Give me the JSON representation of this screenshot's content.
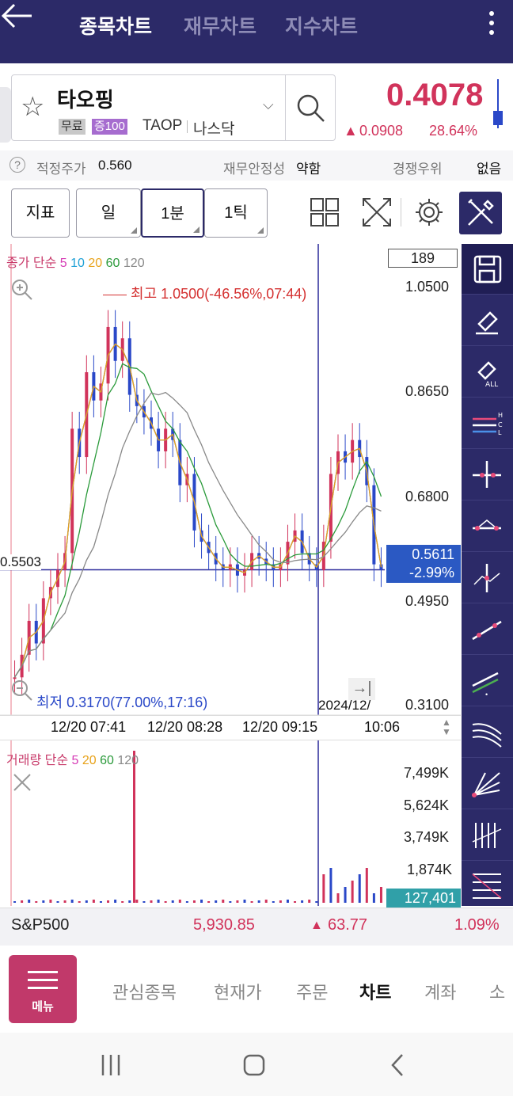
{
  "header": {
    "tabs": [
      {
        "label": "종목차트",
        "active": true
      },
      {
        "label": "재무차트",
        "active": false
      },
      {
        "label": "지수차트",
        "active": false
      }
    ]
  },
  "stock": {
    "name": "타오핑",
    "badges": [
      "무료",
      "증100"
    ],
    "ticker": "TAOP",
    "exchange": "나스닥",
    "price": "0.4078",
    "change": "0.0908",
    "change_pct": "28.64%"
  },
  "info": {
    "fair_price_label": "적정주가",
    "fair_price_value": "0.560",
    "fin_stability_label": "재무안정성",
    "fin_stability_value": "약함",
    "competition_label": "경쟁우위",
    "competition_value": "없음"
  },
  "toolbar": {
    "indicator": "지표",
    "day": "일",
    "minute": "1분",
    "tick": "1틱"
  },
  "chart_data": [
    {
      "type": "candlestick",
      "legend": {
        "prefix": "종가 단순",
        "periods": [
          "5",
          "10",
          "20",
          "60",
          "120"
        ]
      },
      "count_box": "189",
      "y_ticks": [
        "1.0500",
        "0.8650",
        "0.6800",
        "0.4950",
        "0.3100"
      ],
      "ylim": [
        0.31,
        1.05
      ],
      "high_annotation": "최고 1.0500(-46.56%,07:44)",
      "low_annotation": "최저 0.3170(77.00%,17:16)",
      "crosshair_value": "0.5503",
      "last_price": "0.5611",
      "last_change": "-2.99%",
      "date_label": "2024/12/",
      "x_ticks": [
        "12/20 07:41",
        "12/20 08:28",
        "12/20 09:15",
        "10:06"
      ],
      "closes": [
        0.36,
        0.4,
        0.46,
        0.42,
        0.5,
        0.52,
        0.55,
        0.58,
        0.8,
        0.75,
        0.9,
        0.85,
        0.88,
        0.98,
        0.92,
        0.96,
        0.86,
        0.84,
        0.82,
        0.8,
        0.76,
        0.8,
        0.78,
        0.7,
        0.72,
        0.62,
        0.6,
        0.58,
        0.56,
        0.55,
        0.56,
        0.54,
        0.55,
        0.58,
        0.57,
        0.56,
        0.55,
        0.56,
        0.6,
        0.62,
        0.58,
        0.56,
        0.55,
        0.6,
        0.72,
        0.76,
        0.74,
        0.78,
        0.75,
        0.7,
        0.56,
        0.55
      ]
    },
    {
      "type": "bar",
      "legend": {
        "prefix": "거래량 단순",
        "periods": [
          "5",
          "20",
          "60",
          "120"
        ]
      },
      "y_ticks": [
        "7,499K",
        "5,624K",
        "3,749K",
        "1,874K"
      ],
      "last_volume": "127,401"
    }
  ],
  "index_row": {
    "name": "S&P500",
    "value": "5,930.85",
    "change": "63.77",
    "pct": "1.09%"
  },
  "nav": {
    "menu_label": "메뉴",
    "items": [
      {
        "label": "관심종목",
        "active": false
      },
      {
        "label": "현재가",
        "active": false
      },
      {
        "label": "주문",
        "active": false
      },
      {
        "label": "차트",
        "active": true
      },
      {
        "label": "계좌",
        "active": false
      },
      {
        "label": "소",
        "active": false
      }
    ]
  },
  "colors": {
    "brand": "#2c2a68",
    "up": "#d1335b",
    "down": "#2a48c8",
    "ma5": "#d63ab5",
    "ma10": "#1ea0d6",
    "ma20": "#e8a21a",
    "ma60": "#2a9a3a",
    "ma120": "#888888"
  }
}
